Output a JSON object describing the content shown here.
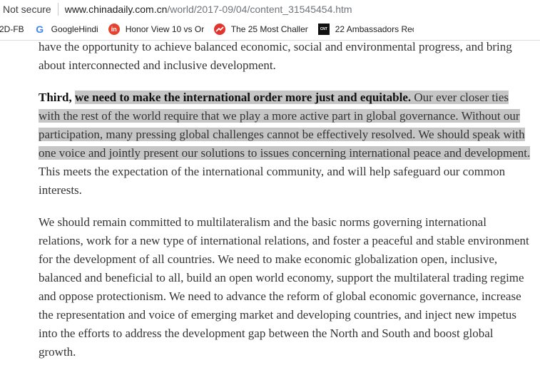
{
  "browser": {
    "security_label": "Not secure",
    "url_host": "www.chinadaily.com.cn",
    "url_path": "/world/2017-09/04/content_31545454.htm"
  },
  "bookmarks": [
    {
      "label": "2D-FB",
      "icon": ""
    },
    {
      "label": "GoogleHindi",
      "icon": "google-icon"
    },
    {
      "label": "Honor View 10 vs Or",
      "icon": "in-icon"
    },
    {
      "label": "The 25 Most Challen",
      "icon": "trending-icon"
    },
    {
      "label": "22 Ambassadors Rec",
      "icon": "cnt-icon"
    }
  ],
  "article": {
    "p1": "have the opportunity to achieve balanced economic, social and environmental progress, and bring about interconnected and inclusive development.",
    "p2_lead": "Third,",
    "p2_bold_highlight": "we need to make the international order more just and equitable.",
    "p2_highlight": "Our ever closer ties with the rest of the world require that we play a more active part in global governance. Without our participation, many pressing global challenges cannot be effectively resolved. We should speak with one voice and jointly present our solutions to issues concerning international peace and development.",
    "p2_rest": "This meets the expectation of the international community, and will help safeguard our common interests.",
    "p3": "We should remain committed to multilateralism and the basic norms governing international relations, work for a new type of international relations, and foster a peaceful and stable environment for the development of all countries. We need to make economic globalization open, inclusive, balanced and beneficial to all, build an open world economy, support the multilateral trading regime and oppose protectionism. We need to advance the reform of global economic governance, increase the representation and voice of emerging market and developing countries, and inject new impetus into the efforts to address the development gap between the North and South and boost global growth."
  },
  "colors": {
    "highlight": "#c6c6c6",
    "text": "#333333"
  }
}
